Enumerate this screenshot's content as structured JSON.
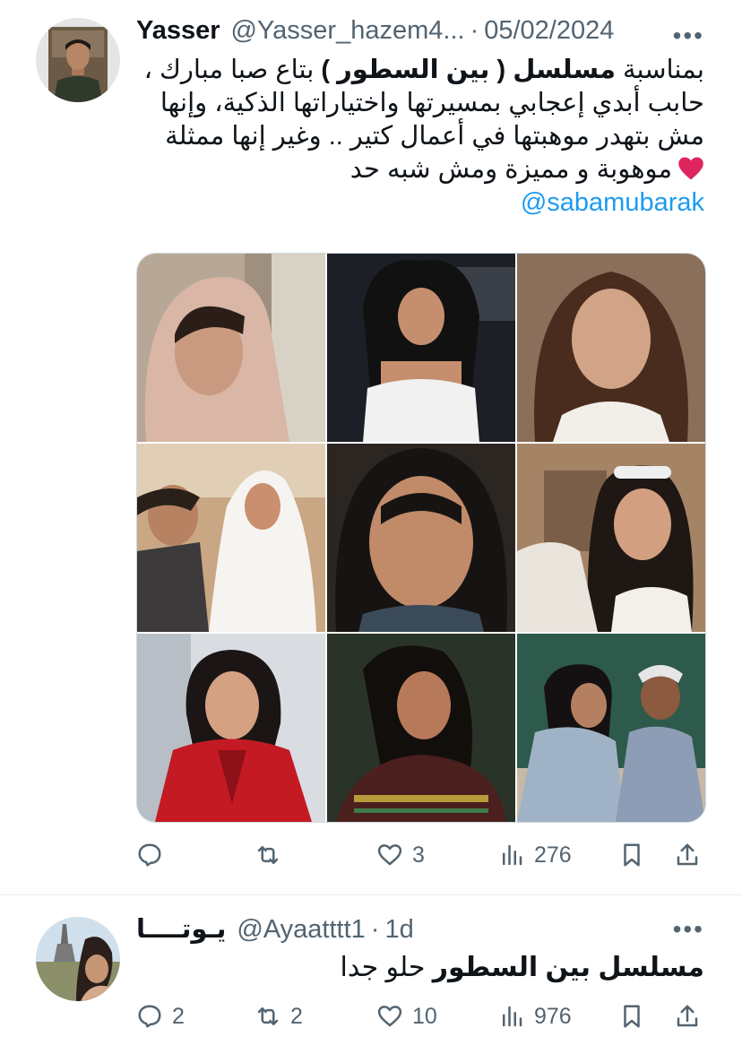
{
  "tweets": [
    {
      "name": "Yasser",
      "handle": "@Yasser_hazem4...",
      "separator": "·",
      "time": "05/02/2024",
      "text_lines": [
        "بمناسبة مسلسل ( بين السطور ) بتاع صبا مبارك ،",
        "حابب أبدي إعجابي بمسيرتها واختياراتها الذكية، وإنها",
        "مش بتهدر موهبتها في أعمال كتير .. وغير إنها ممثلة",
        "موهوبة و مميزة ومش شبه حد"
      ],
      "emoji": "heart-emoji",
      "mention": "@sabamubarak",
      "actions": {
        "replies": "",
        "retweets": "",
        "likes": "3",
        "views": "276"
      }
    },
    {
      "name": "يـوتــــا",
      "handle": "@Ayaatttt1",
      "separator": "·",
      "time": "1d",
      "text_bold": "مسلسل بين السطور",
      "text_rest": " حلو جدا",
      "actions": {
        "replies": "2",
        "retweets": "2",
        "likes": "10",
        "views": "976"
      }
    }
  ],
  "colors": {
    "text": "#0f1419",
    "secondary": "#536471",
    "link": "#1d9bf0",
    "heart": "#e0245e",
    "divider": "#e6ecf0"
  },
  "media_grid": {
    "rows": 3,
    "cols": 3,
    "cells": [
      "woman-in-pink-headscarf",
      "woman-in-white-strapless-dress",
      "woman-with-long-brown-hair",
      "man-and-woman-in-white-veil",
      "woman-in-black-headscarf",
      "woman-with-sunglasses-on-head",
      "woman-in-red-blazer",
      "woman-in-dark-embroidered-dress",
      "two-women-laughing"
    ]
  }
}
